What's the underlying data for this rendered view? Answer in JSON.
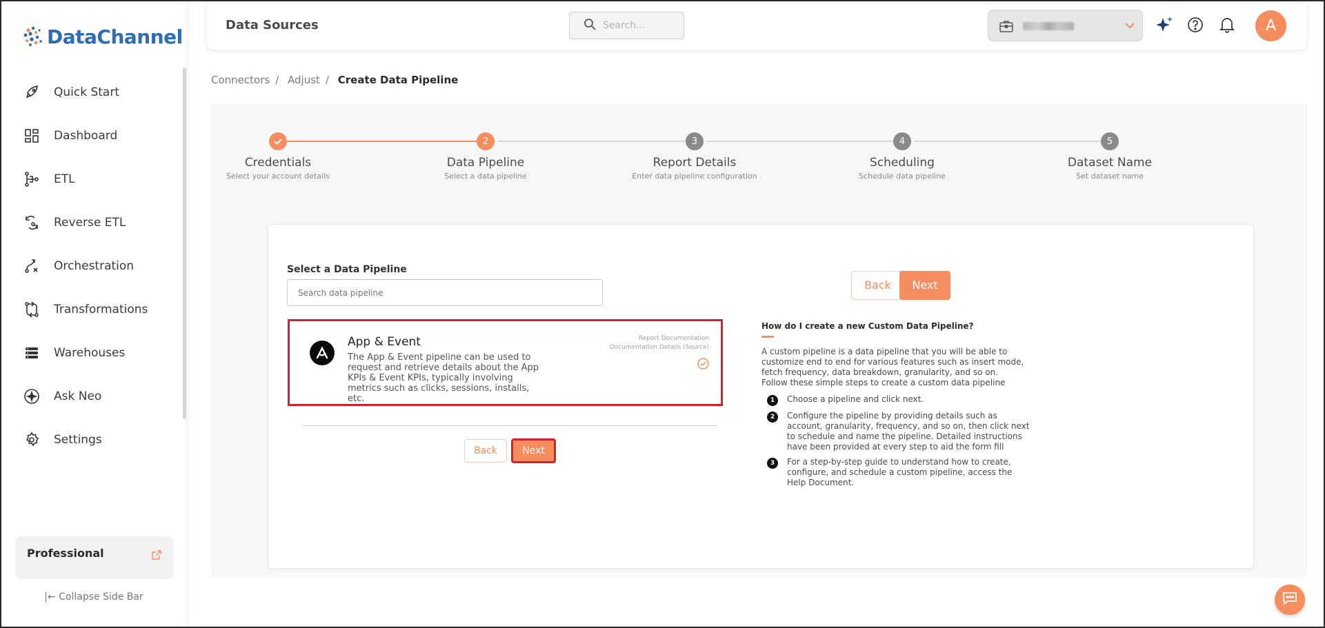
{
  "brand": {
    "name_part1": "Data",
    "name_part2": "Channel"
  },
  "sidebar": {
    "items": [
      {
        "label": "Quick Start",
        "icon": "rocket-icon"
      },
      {
        "label": "Dashboard",
        "icon": "dashboard-icon"
      },
      {
        "label": "ETL",
        "icon": "etl-icon"
      },
      {
        "label": "Reverse ETL",
        "icon": "reverse-etl-icon"
      },
      {
        "label": "Orchestration",
        "icon": "orchestration-icon"
      },
      {
        "label": "Transformations",
        "icon": "transformations-icon"
      },
      {
        "label": "Warehouses",
        "icon": "warehouses-icon"
      },
      {
        "label": "Ask Neo",
        "icon": "ask-neo-icon"
      },
      {
        "label": "Settings",
        "icon": "settings-icon"
      }
    ],
    "plan_label": "Professional",
    "collapse_label": "Collapse Side Bar"
  },
  "topbar": {
    "title": "Data Sources",
    "search_placeholder": "Search...",
    "avatar_initial": "A"
  },
  "breadcrumb": {
    "items": [
      "Connectors",
      "Adjust"
    ],
    "current": "Create Data Pipeline"
  },
  "stepper": {
    "steps": [
      {
        "number": "1",
        "title": "Credentials",
        "subtitle": "Select your account details",
        "state": "done"
      },
      {
        "number": "2",
        "title": "Data Pipeline",
        "subtitle": "Select a data pipeline",
        "state": "active"
      },
      {
        "number": "3",
        "title": "Report Details",
        "subtitle": "Enter data pipeline configuration",
        "state": "pending"
      },
      {
        "number": "4",
        "title": "Scheduling",
        "subtitle": "Schedule data pipeline",
        "state": "pending"
      },
      {
        "number": "5",
        "title": "Dataset Name",
        "subtitle": "Set dataset name",
        "state": "pending"
      }
    ]
  },
  "pipeline": {
    "section_label": "Select a Data Pipeline",
    "search_placeholder": "Search data pipeline",
    "card": {
      "name": "App & Event",
      "description": "The App & Event pipeline can be used to request and retrieve details about the App KPIs & Event KPIs, typically involving metrics such as clicks, sessions, installs, etc.",
      "doc_link_1": "Report Documentation",
      "doc_link_2": "Documentation Details (Source)"
    },
    "back_label": "Back",
    "next_label": "Next"
  },
  "help": {
    "title": "How do I create a new Custom Data Pipeline?",
    "intro": "A custom pipeline is a data pipeline that you will be able to customize end to end for various features such as insert mode, fetch frequency, data breakdown, granularity, and so on.",
    "intro2": "Follow these simple steps to create a custom data pipeline",
    "steps": [
      {
        "num": "1",
        "text": "Choose a pipeline and click next."
      },
      {
        "num": "2",
        "text": "Configure the pipeline by providing details such as account, granularity, frequency, and so on, then click next to schedule and name the pipeline. Detailed instructions have been provided at every step to aid the form fill"
      },
      {
        "num": "3",
        "text": "For a step-by-step guide to understand how to create, configure, and schedule a custom pipeline, access the Help Document."
      }
    ]
  },
  "colors": {
    "accent": "#f58d5f",
    "brand_blue": "#2e6db4",
    "highlight_red": "#d4202a",
    "step_pending": "#8a8a8a"
  }
}
